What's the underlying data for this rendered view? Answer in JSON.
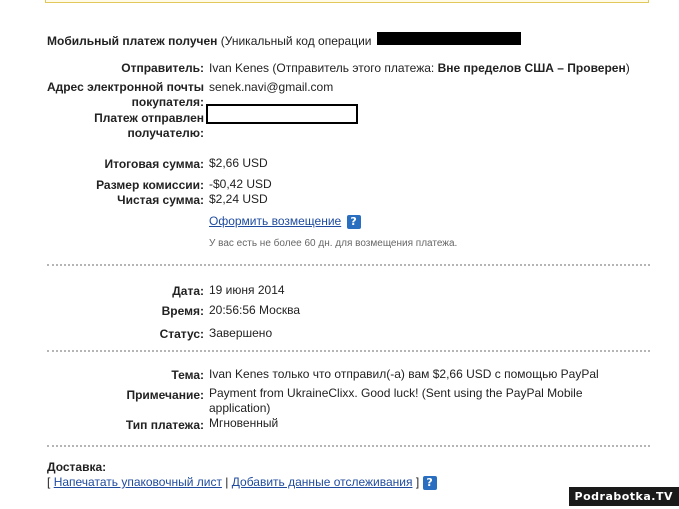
{
  "header": {
    "title": "Мобильный платеж получен",
    "code_label": "(Уникальный код операции"
  },
  "sender": {
    "label": "Отправитель:",
    "name": "Ivan Kenes",
    "note_prefix": "(Отправитель этого платежа:",
    "status": "Вне пределов США – Проверен",
    "note_suffix": ")"
  },
  "buyer_email": {
    "label_line1": "Адрес электронной почты",
    "label_line2": "покупателя:",
    "value": "senek.navi@gmail.com"
  },
  "sent_to": {
    "label_line1": "Платеж отправлен",
    "label_line2": "получателю:"
  },
  "amounts": {
    "total_label": "Итоговая сумма:",
    "total_value": "$2,66 USD",
    "fee_label": "Размер комиссии:",
    "fee_value": "-$0,42 USD",
    "net_label": "Чистая сумма:",
    "net_value": "$2,24 USD"
  },
  "refund": {
    "link_label": "Оформить возмещение",
    "help_icon": "?",
    "hint": "У вас есть не более 60 дн. для возмещения платежа."
  },
  "details": {
    "date_label": "Дата:",
    "date_value": "19 июня 2014",
    "time_label": "Время:",
    "time_value": "20:56:56 Москва",
    "status_label": "Статус:",
    "status_value": "Завершено"
  },
  "message": {
    "subject_label": "Тема:",
    "subject_value": "Ivan Kenes только что отправил(-а) вам $2,66 USD с помощью PayPal",
    "note_label": "Примечание:",
    "note_line1": "Payment from UkraineClixx. Good luck! (Sent using the PayPal Mobile",
    "note_line2": "application)",
    "type_label": "Тип платежа:",
    "type_value": "Мгновенный"
  },
  "shipping": {
    "title": "Доставка:",
    "bracket_open": "[",
    "print_link": "Напечатать упаковочный лист",
    "divider": "|",
    "tracking_link": "Добавить данные отслеживания",
    "bracket_close": "]",
    "help_icon": "?"
  },
  "watermark": "Podrabotka.TV",
  "colors": {
    "link": "#1f4b9e",
    "help_icon_bg": "#2a6fbf",
    "separator": "#b5b5b5",
    "top_border": "#e0c95a"
  }
}
